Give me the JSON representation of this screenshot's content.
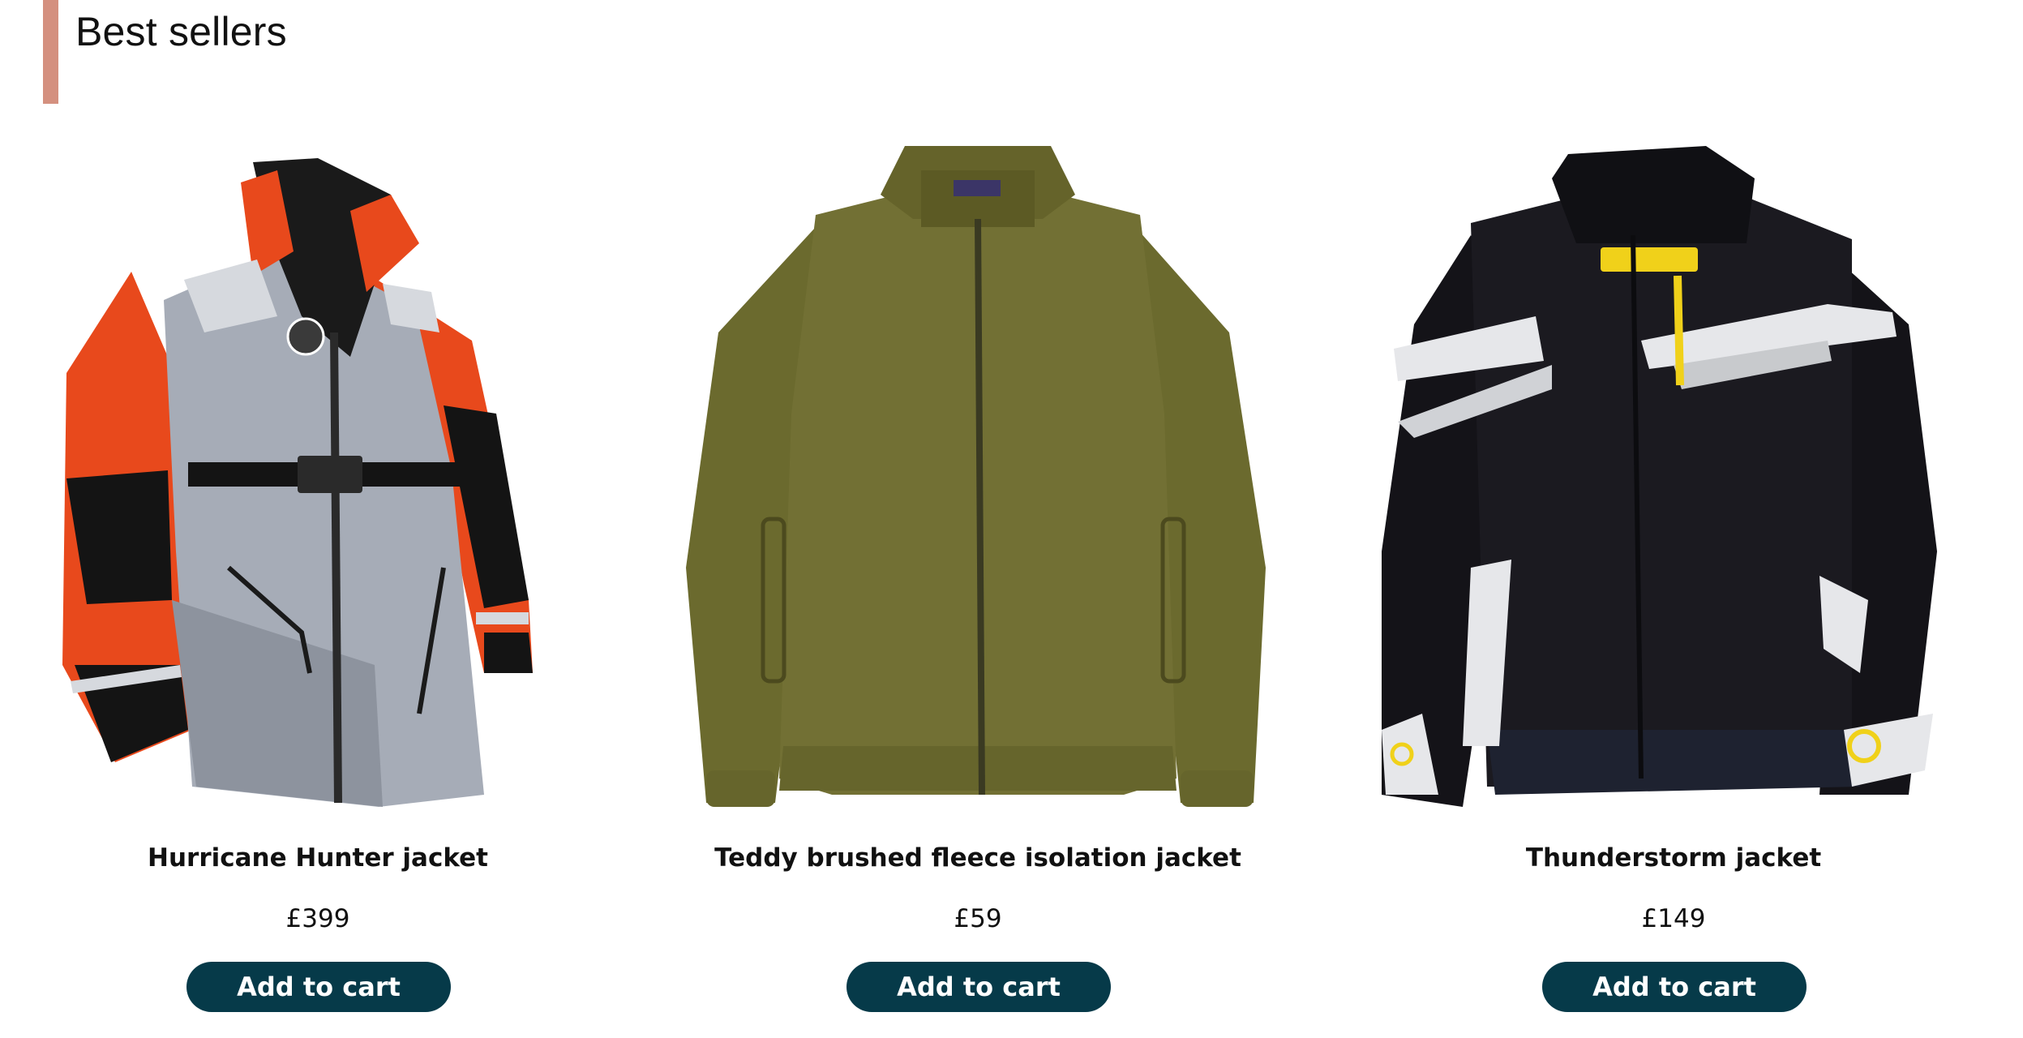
{
  "section": {
    "title": "Best sellers"
  },
  "colors": {
    "accent": "#d4907f",
    "button_bg": "#063a49",
    "button_text": "#ffffff"
  },
  "products": [
    {
      "name": "Hurricane Hunter jacket",
      "price": "£399",
      "button_label": "Add to cart",
      "image_icon": "orange-grey-parka-jacket"
    },
    {
      "name": "Teddy brushed fleece isolation jacket",
      "price": "£59",
      "button_label": "Add to cart",
      "image_icon": "olive-fleece-jacket"
    },
    {
      "name": "Thunderstorm jacket",
      "price": "£149",
      "button_label": "Add to cart",
      "image_icon": "black-white-moto-jacket"
    }
  ]
}
